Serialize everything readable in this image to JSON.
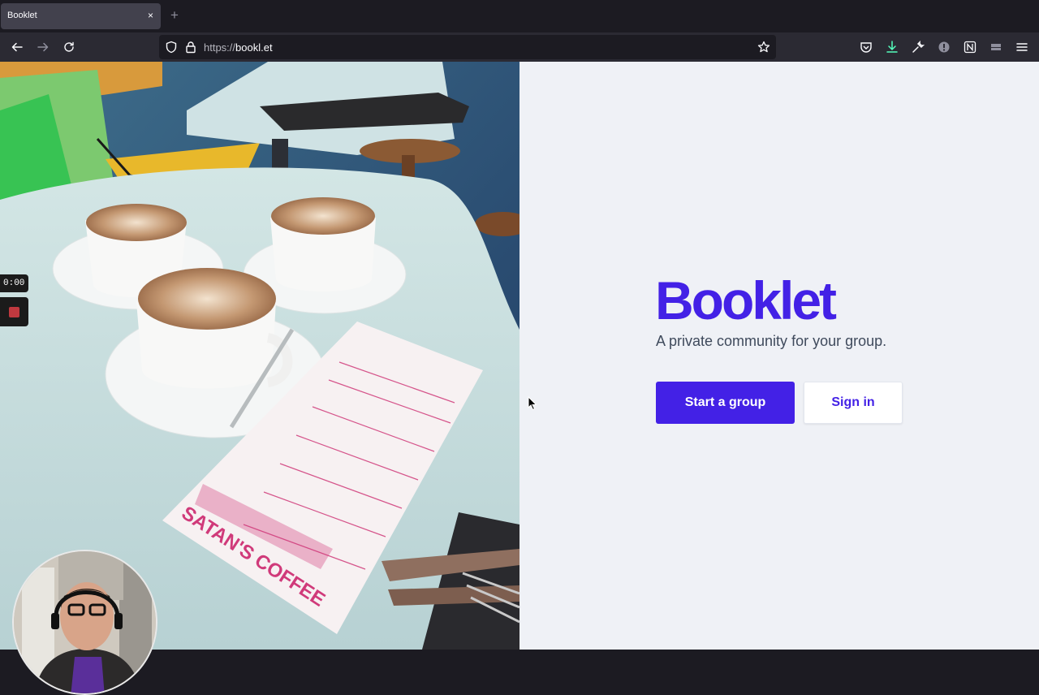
{
  "browser": {
    "tab_title": "Booklet",
    "tab_close": "×",
    "new_tab": "+",
    "url_scheme": "https://",
    "url_host": "bookl.et"
  },
  "hero": {
    "brand": "Booklet",
    "tagline": "A private community for your group.",
    "primary_button": "Start a group",
    "secondary_button": "Sign in",
    "accent_color": "#4321e6"
  },
  "photo": {
    "menu_title": "SATAN'S COFFEE"
  },
  "recorder": {
    "timer": "0:00"
  }
}
